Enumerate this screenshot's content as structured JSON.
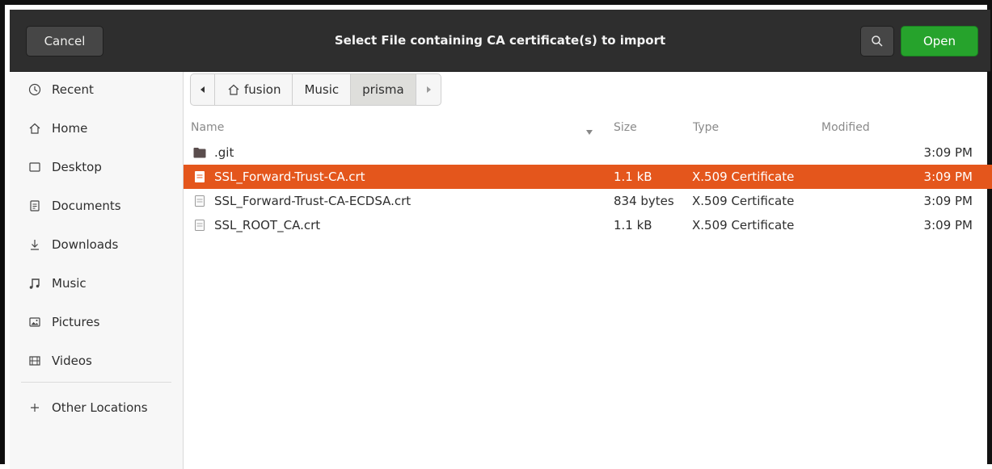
{
  "dialog": {
    "title": "Select File containing CA certificate(s) to import",
    "cancel_label": "Cancel",
    "open_label": "Open",
    "accent_color": "#26a32c",
    "selection_color": "#e4561c"
  },
  "sidebar": {
    "items": [
      {
        "label": "Recent",
        "icon": "clock-icon"
      },
      {
        "label": "Home",
        "icon": "home-icon"
      },
      {
        "label": "Desktop",
        "icon": "desktop-icon"
      },
      {
        "label": "Documents",
        "icon": "documents-icon"
      },
      {
        "label": "Downloads",
        "icon": "downloads-icon"
      },
      {
        "label": "Music",
        "icon": "music-icon"
      },
      {
        "label": "Pictures",
        "icon": "pictures-icon"
      },
      {
        "label": "Videos",
        "icon": "videos-icon"
      }
    ],
    "other_locations": "Other Locations"
  },
  "pathbar": {
    "crumbs": [
      "fusion",
      "Music",
      "prisma"
    ]
  },
  "columns": {
    "name": "Name",
    "size": "Size",
    "type": "Type",
    "modified": "Modified"
  },
  "files": [
    {
      "name": ".git",
      "size": "",
      "type": "",
      "modified": "3:09 PM",
      "kind": "folder",
      "selected": false
    },
    {
      "name": "SSL_Forward-Trust-CA.crt",
      "size": "1.1 kB",
      "type": "X.509 Certificate",
      "modified": "3:09 PM",
      "kind": "file",
      "selected": true
    },
    {
      "name": "SSL_Forward-Trust-CA-ECDSA.crt",
      "size": "834 bytes",
      "type": "X.509 Certificate",
      "modified": "3:09 PM",
      "kind": "file",
      "selected": false
    },
    {
      "name": "SSL_ROOT_CA.crt",
      "size": "1.1 kB",
      "type": "X.509 Certificate",
      "modified": "3:09 PM",
      "kind": "file",
      "selected": false
    }
  ]
}
